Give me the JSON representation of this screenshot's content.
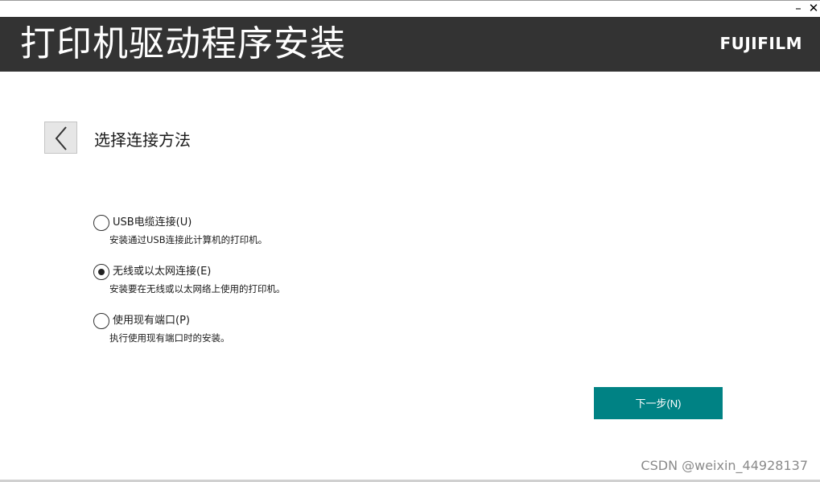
{
  "window": {
    "minimize_glyph": "–",
    "close_glyph": "✕"
  },
  "header": {
    "title": "打印机驱动程序安装",
    "brand": "FUJIFILM",
    "background": "#333333"
  },
  "page": {
    "back_icon": "chevron-left-icon",
    "section_title": "选择连接方法"
  },
  "options": [
    {
      "label": "USB电缆连接(U)",
      "description": "安装通过USB连接此计算机的打印机。",
      "selected": false
    },
    {
      "label": "无线或以太网连接(E)",
      "description": "安装要在无线或以太网络上使用的打印机。",
      "selected": true
    },
    {
      "label": "使用现有端口(P)",
      "description": "执行使用现有端口时的安装。",
      "selected": false
    }
  ],
  "footer": {
    "next_label": "下一步(N)",
    "next_color": "#008284",
    "watermark": "CSDN @weixin_44928137"
  }
}
